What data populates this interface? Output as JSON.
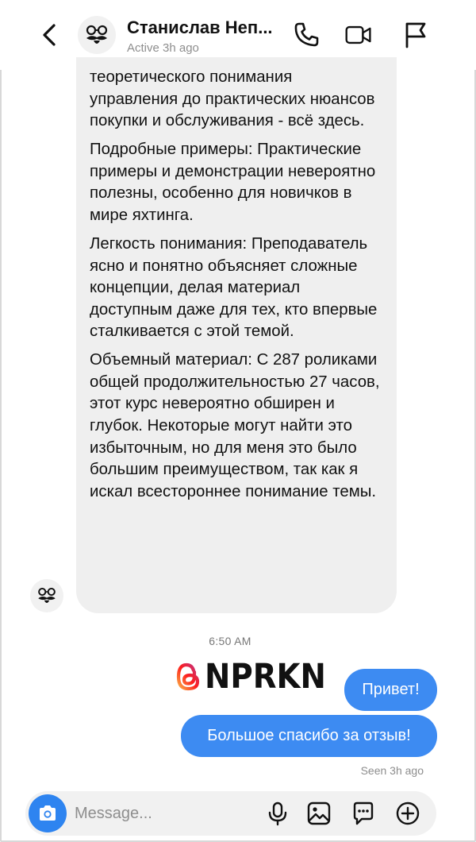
{
  "header": {
    "contact_name": "Станислав Неп...",
    "status": "Active 3h ago"
  },
  "icons": {
    "back": "chevron-left-icon",
    "avatar": "mustache-glasses-avatar",
    "call": "phone-icon",
    "video": "video-camera-icon",
    "report": "flag-icon",
    "camera": "camera-icon",
    "mic": "microphone-icon",
    "gallery": "image-icon",
    "sticker": "sticker-icon",
    "more": "plus-circle-icon"
  },
  "conversation": {
    "received_paragraphs": [
      "теоретического понимания управления до практических нюансов покупки и обслуживания - всё здесь.",
      "Подробные примеры: Практические примеры и демонстрации невероятно полезны, особенно для новичков в мире яхтинга.",
      "Легкость понимания: Преподаватель ясно и понятно объясняет сложные концепции, делая материал доступным даже для тех, кто впервые сталкивается с этой темой.",
      "Объемный материал: С 287 роликами общей продолжительностью 27 часов, этот курс невероятно обширен и глубок. Некоторые могут найти это избыточным, но для меня это было большим преимуществом, так как я искал всестороннее понимание темы."
    ],
    "timestamp": "6:50 AM",
    "sent_messages": [
      "Привет!",
      "Большое спасибо за отзыв!"
    ],
    "seen_status": "Seen 3h ago"
  },
  "watermark": {
    "text": "NPRKN"
  },
  "composer": {
    "placeholder": "Message..."
  },
  "colors": {
    "sent_bubble": "#3d8bf2",
    "received_bubble": "#efefef",
    "camera_button": "#2e84f0"
  }
}
